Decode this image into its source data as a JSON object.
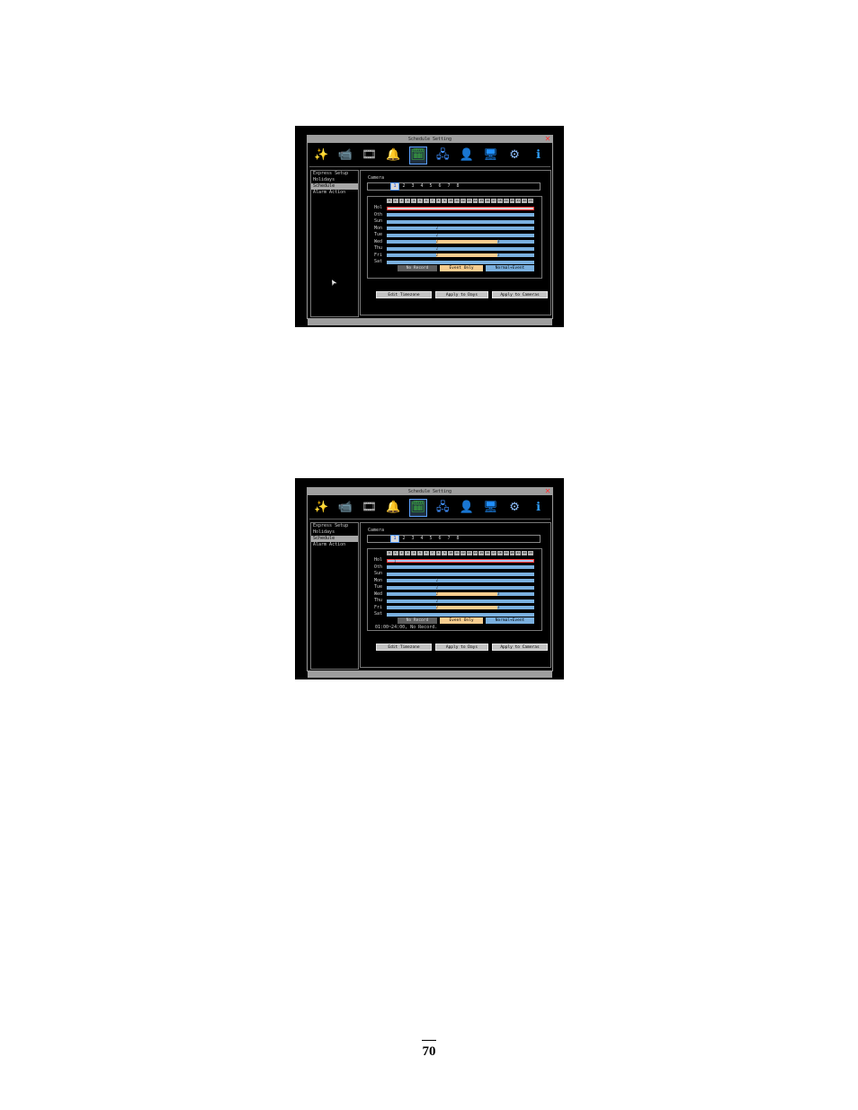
{
  "screenshots": [
    {
      "title": "Schedule Setting",
      "close_glyph": "✕",
      "icons": [
        {
          "name": "wand-icon",
          "glyph": "✨",
          "color": "#f0d060"
        },
        {
          "name": "camera-icon",
          "glyph": "📹",
          "color": "#d0d0d0"
        },
        {
          "name": "film-reel-icon",
          "glyph": "🎞",
          "color": "#d0d0d0"
        },
        {
          "name": "bell-icon",
          "glyph": "🔔",
          "color": "#f0c020"
        },
        {
          "name": "schedule-icon",
          "glyph": "🗓",
          "color": "#40c040",
          "selected": true
        },
        {
          "name": "network-icon",
          "glyph": "🖧",
          "color": "#4090ff"
        },
        {
          "name": "user-icon",
          "glyph": "👤",
          "color": "#e0a020"
        },
        {
          "name": "monitor-icon",
          "glyph": "🖥",
          "color": "#2090ff"
        },
        {
          "name": "gears-icon",
          "glyph": "⚙",
          "color": "#90c0ff"
        },
        {
          "name": "info-icon",
          "glyph": "ℹ",
          "color": "#30a0ff"
        }
      ],
      "menu": [
        {
          "label": "Express Setup",
          "active": false
        },
        {
          "label": "Holidays",
          "active": false
        },
        {
          "label": "Schedule",
          "active": true
        },
        {
          "label": "Alarm Action",
          "active": false
        }
      ],
      "camera_label": "Camera",
      "cameras": [
        "1",
        "2",
        "3",
        "4",
        "5",
        "6",
        "7",
        "8"
      ],
      "selected_camera": "1",
      "hours": [
        "0",
        "1",
        "2",
        "3",
        "4",
        "5",
        "6",
        "7",
        "8",
        "9",
        "10",
        "11",
        "12",
        "13",
        "14",
        "15",
        "16",
        "17",
        "18",
        "19",
        "20",
        "21",
        "22",
        "23"
      ],
      "days": [
        {
          "label": "Hol",
          "type": "holiday",
          "marks": []
        },
        {
          "label": "Oth",
          "type": "normal",
          "marks": []
        },
        {
          "label": "Sun",
          "type": "normal",
          "marks": []
        },
        {
          "label": "Mon",
          "type": "normal",
          "marks": [
            {
              "hour": 8,
              "text": "2"
            }
          ]
        },
        {
          "label": "Tue",
          "type": "normal",
          "marks": [
            {
              "hour": 8,
              "text": "2"
            }
          ]
        },
        {
          "label": "Wed",
          "type": "event",
          "event": [
            8,
            18
          ],
          "marks": [
            {
              "hour": 8,
              "text": "2"
            },
            {
              "hour": 18,
              "text": "3"
            }
          ]
        },
        {
          "label": "Thu",
          "type": "normal",
          "marks": [
            {
              "hour": 8,
              "text": "2"
            }
          ]
        },
        {
          "label": "Fri",
          "type": "event",
          "event": [
            8,
            18
          ],
          "marks": [
            {
              "hour": 8,
              "text": "2"
            },
            {
              "hour": 18,
              "text": "3"
            }
          ]
        },
        {
          "label": "Sat",
          "type": "normal",
          "marks": []
        }
      ],
      "legend": {
        "no_record": "No Record",
        "event_only": "Event Only",
        "normal_event": "Normal+Event"
      },
      "status": "",
      "buttons": {
        "edit_timezone": "Edit Timezone",
        "apply_days": "Apply to Days",
        "apply_cameras": "Apply to Cameras"
      },
      "show_cursor": true,
      "cursor_glyph": "➤"
    },
    {
      "title": "Schedule Setting",
      "close_glyph": "✕",
      "icons": [
        {
          "name": "wand-icon",
          "glyph": "✨",
          "color": "#f0d060"
        },
        {
          "name": "camera-icon",
          "glyph": "📹",
          "color": "#d0d0d0"
        },
        {
          "name": "film-reel-icon",
          "glyph": "🎞",
          "color": "#d0d0d0"
        },
        {
          "name": "bell-icon",
          "glyph": "🔔",
          "color": "#f0c020"
        },
        {
          "name": "schedule-icon",
          "glyph": "🗓",
          "color": "#40c040",
          "selected": true
        },
        {
          "name": "network-icon",
          "glyph": "🖧",
          "color": "#4090ff"
        },
        {
          "name": "user-icon",
          "glyph": "👤",
          "color": "#e0a020"
        },
        {
          "name": "monitor-icon",
          "glyph": "🖥",
          "color": "#2090ff"
        },
        {
          "name": "gears-icon",
          "glyph": "⚙",
          "color": "#90c0ff"
        },
        {
          "name": "info-icon",
          "glyph": "ℹ",
          "color": "#30a0ff"
        }
      ],
      "menu": [
        {
          "label": "Express Setup",
          "active": false
        },
        {
          "label": "Holidays",
          "active": false
        },
        {
          "label": "Schedule",
          "active": true
        },
        {
          "label": "Alarm Action",
          "active": false
        }
      ],
      "camera_label": "Camera",
      "cameras": [
        "1",
        "2",
        "3",
        "4",
        "5",
        "6",
        "7",
        "8"
      ],
      "selected_camera": "1",
      "hours": [
        "0",
        "1",
        "2",
        "3",
        "4",
        "5",
        "6",
        "7",
        "8",
        "9",
        "10",
        "11",
        "12",
        "13",
        "14",
        "15",
        "16",
        "17",
        "18",
        "19",
        "20",
        "21",
        "22",
        "23"
      ],
      "days": [
        {
          "label": "Hol",
          "type": "holiday-selected",
          "marks": [
            {
              "hour": 1,
              "text": "1"
            }
          ]
        },
        {
          "label": "Oth",
          "type": "normal",
          "marks": []
        },
        {
          "label": "Sun",
          "type": "normal",
          "marks": []
        },
        {
          "label": "Mon",
          "type": "normal",
          "marks": [
            {
              "hour": 8,
              "text": "2"
            }
          ]
        },
        {
          "label": "Tue",
          "type": "normal",
          "marks": [
            {
              "hour": 8,
              "text": "2"
            }
          ]
        },
        {
          "label": "Wed",
          "type": "event",
          "event": [
            8,
            18
          ],
          "marks": [
            {
              "hour": 8,
              "text": "2"
            },
            {
              "hour": 18,
              "text": "3"
            }
          ]
        },
        {
          "label": "Thu",
          "type": "normal",
          "marks": [
            {
              "hour": 8,
              "text": "2"
            }
          ]
        },
        {
          "label": "Fri",
          "type": "event",
          "event": [
            8,
            18
          ],
          "marks": [
            {
              "hour": 8,
              "text": "2"
            },
            {
              "hour": 18,
              "text": "3"
            }
          ]
        },
        {
          "label": "Sat",
          "type": "normal",
          "marks": []
        }
      ],
      "legend": {
        "no_record": "No Record",
        "event_only": "Event Only",
        "normal_event": "Normal+Event"
      },
      "status": "01:00~24:00, No Record.",
      "buttons": {
        "edit_timezone": "Edit Timezone",
        "apply_days": "Apply to Days",
        "apply_cameras": "Apply to Cameras"
      },
      "show_cursor": false,
      "cursor_glyph": "➤"
    }
  ],
  "page_number": "70"
}
